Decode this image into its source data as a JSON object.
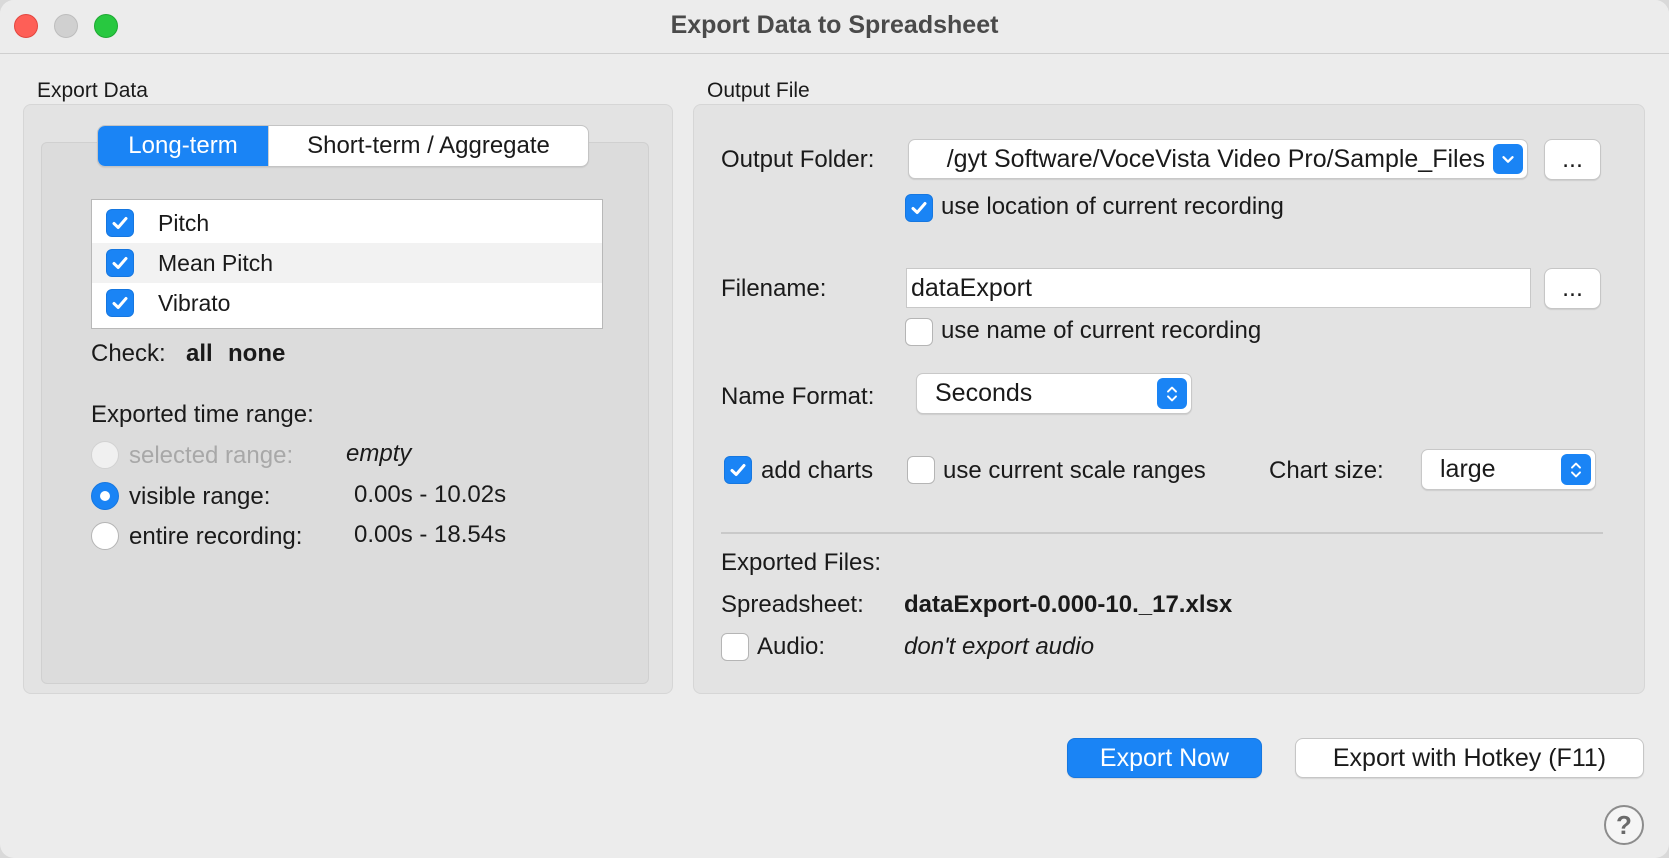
{
  "window": {
    "title": "Export Data to Spreadsheet"
  },
  "export_data": {
    "group_label": "Export Data",
    "tabs": [
      "Long-term",
      "Short-term / Aggregate"
    ],
    "list_items": [
      {
        "label": "Pitch",
        "checked": true
      },
      {
        "label": "Mean Pitch",
        "checked": true
      },
      {
        "label": "Vibrato",
        "checked": true
      }
    ],
    "check_label": "Check:",
    "check_all": "all",
    "check_none": "none",
    "time_range_label": "Exported time range:",
    "ranges": [
      {
        "label": "selected range:",
        "value": "empty",
        "state": "disabled"
      },
      {
        "label": "visible range:",
        "value": "0.00s - 10.02s",
        "state": "selected"
      },
      {
        "label": "entire recording:",
        "value": "0.00s - 18.54s",
        "state": "unselected"
      }
    ]
  },
  "output_file": {
    "group_label": "Output File",
    "folder_label": "Output Folder:",
    "folder_value": "/gyt Software/VoceVista Video Pro/Sample_Files",
    "folder_browse": "...",
    "use_location_label": "use location of current recording",
    "use_location_checked": true,
    "filename_label": "Filename:",
    "filename_value": "dataExport",
    "filename_browse": "...",
    "use_name_label": "use name of current recording",
    "use_name_checked": false,
    "name_format_label": "Name Format:",
    "name_format_value": "Seconds",
    "add_charts_label": "add charts",
    "add_charts_checked": true,
    "scale_ranges_label": "use current scale ranges",
    "scale_ranges_checked": false,
    "chart_size_label": "Chart size:",
    "chart_size_value": "large",
    "exported_files_label": "Exported Files:",
    "spreadsheet_label": "Spreadsheet:",
    "spreadsheet_value": "dataExport-0.000-10._17.xlsx",
    "audio_label": "Audio:",
    "audio_checked": false,
    "audio_value": "don't export audio"
  },
  "buttons": {
    "export_now": "Export Now",
    "export_hotkey": "Export with Hotkey (F11)",
    "help": "?"
  },
  "colors": {
    "accent": "#1a84f5",
    "close": "#fe5f57",
    "maximize": "#28c840"
  }
}
